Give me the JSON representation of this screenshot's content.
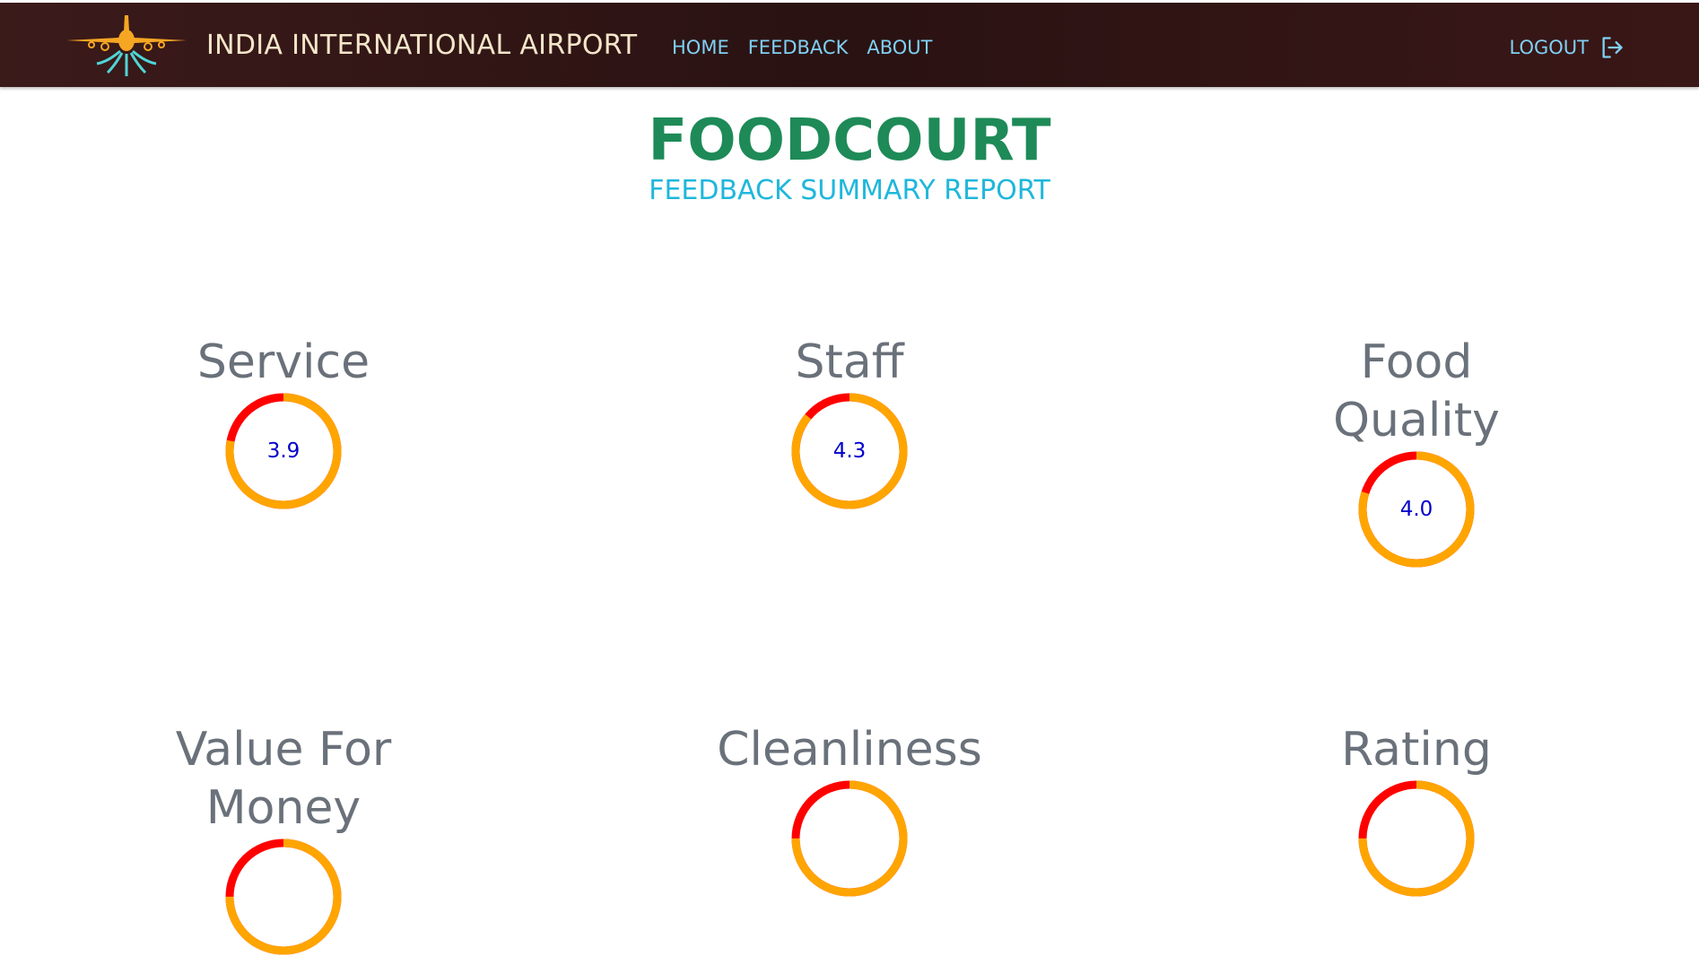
{
  "header": {
    "brand": "INDIA INTERNATIONAL AIRPORT",
    "nav": [
      "HOME",
      "FEEDBACK",
      "ABOUT"
    ],
    "logout_label": "LOGOUT"
  },
  "page": {
    "title": "FOODCOURT",
    "subtitle": "FEEDBACK SUMMARY REPORT"
  },
  "colors": {
    "title": "#1e8a57",
    "subtitle": "#1fb7db",
    "gauge_fill": "#ffa500",
    "gauge_remaining": "#ff0000",
    "gauge_value_text": "#0000cc"
  },
  "metrics": [
    {
      "label": "Service",
      "value": "3.9",
      "max": 5
    },
    {
      "label": "Staff",
      "value": "4.3",
      "max": 5
    },
    {
      "label": "Food Quality",
      "value": "4.0",
      "max": 5
    },
    {
      "label": "Value For Money",
      "value": "",
      "max": 5
    },
    {
      "label": "Cleanliness",
      "value": "",
      "max": 5
    },
    {
      "label": "Rating",
      "value": "",
      "max": 5
    }
  ]
}
